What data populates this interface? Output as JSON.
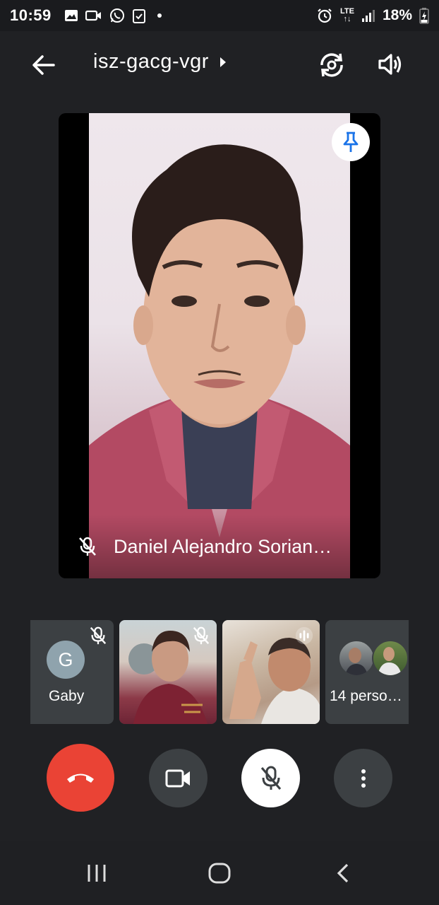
{
  "status_bar": {
    "time": "10:59",
    "lte_top": "LTE",
    "lte_bottom": "↑↓",
    "battery": "18%"
  },
  "top_bar": {
    "meeting_code": "isz-gacg-vgr"
  },
  "main_participant": {
    "name": "Daniel Alejandro Sorian…"
  },
  "participants": [
    {
      "label": "Gaby",
      "initial": "G"
    },
    {
      "label": ""
    },
    {
      "label": ""
    },
    {
      "label": "14 person…"
    }
  ],
  "colors": {
    "background": "#202124",
    "tile": "#3c4043",
    "hangup": "#ea4335",
    "pin": "#1a73e8"
  },
  "icons": [
    "back-arrow-icon",
    "chevron-right-icon",
    "switch-camera-icon",
    "speaker-icon",
    "pin-icon",
    "mic-off-icon",
    "audio-wave-icon",
    "phone-hangup-icon",
    "camera-icon",
    "more-vert-icon",
    "recents-icon",
    "home-icon",
    "nav-back-icon"
  ]
}
